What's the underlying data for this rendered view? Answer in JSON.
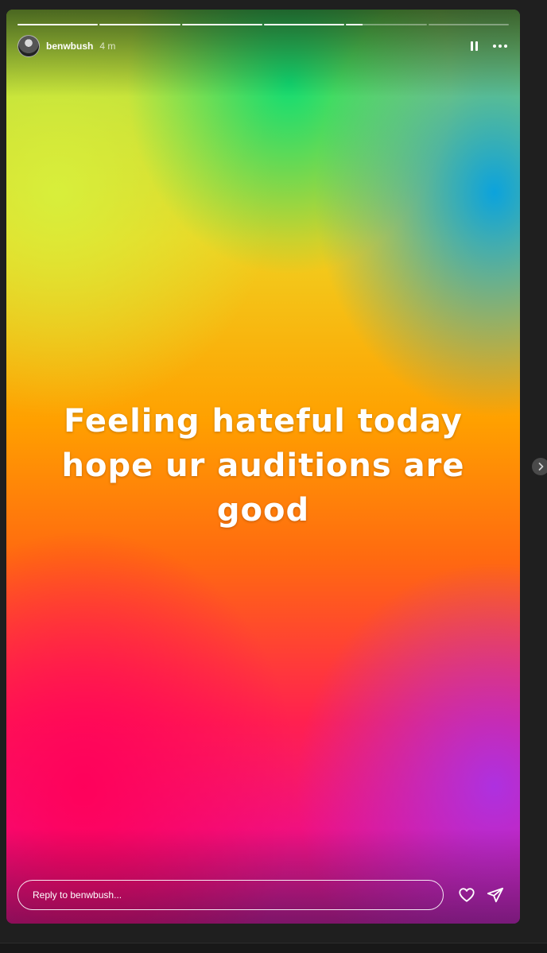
{
  "story": {
    "username": "benwbush",
    "time": "4 m",
    "caption_lines": [
      "Feeling hateful today",
      "hope ur auditions are",
      "good"
    ],
    "progress": [
      1,
      1,
      1,
      1,
      0.2,
      0
    ]
  },
  "footer": {
    "reply_placeholder": "Reply to benwbush..."
  },
  "icons": {
    "pause": "pause-icon",
    "more": "more-icon",
    "like": "heart-icon",
    "share": "send-icon",
    "next": "chevron-right-icon"
  },
  "colors": {
    "background": "#1f1f1f",
    "text": "#ffffff"
  }
}
